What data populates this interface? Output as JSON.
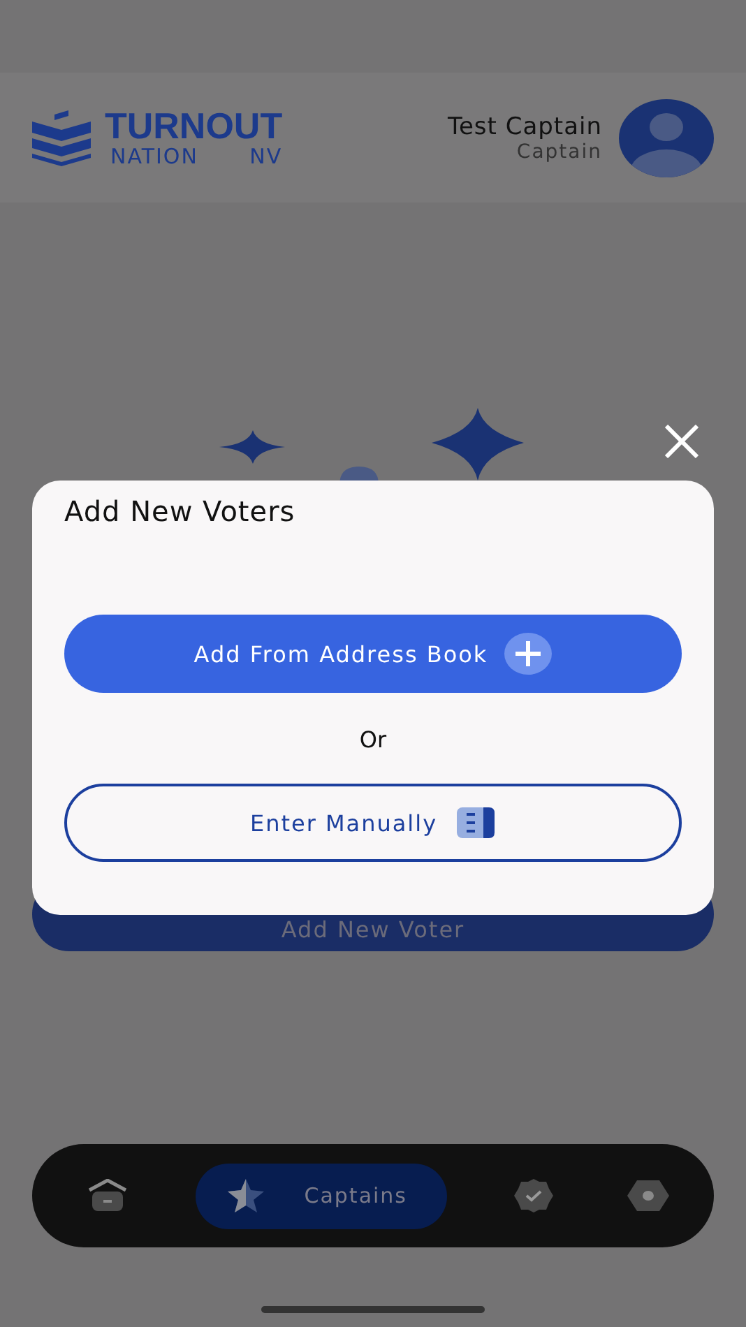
{
  "header": {
    "logo": {
      "title": "TURNOUT",
      "subtitle": "NATION",
      "region": "NV"
    },
    "user": {
      "name": "Test Captain",
      "role": "Captain"
    }
  },
  "background_button": {
    "label": "Add New Voter"
  },
  "modal": {
    "title": "Add New Voters",
    "primary_button": {
      "label": "Add From Address Book"
    },
    "separator": "Or",
    "secondary_button": {
      "label": "Enter Manually"
    }
  },
  "nav": [
    {
      "kind": "home",
      "selected": false
    },
    {
      "kind": "star",
      "label": "Captains",
      "selected": true
    },
    {
      "kind": "badge",
      "selected": false
    },
    {
      "kind": "hexagon",
      "selected": false
    }
  ]
}
